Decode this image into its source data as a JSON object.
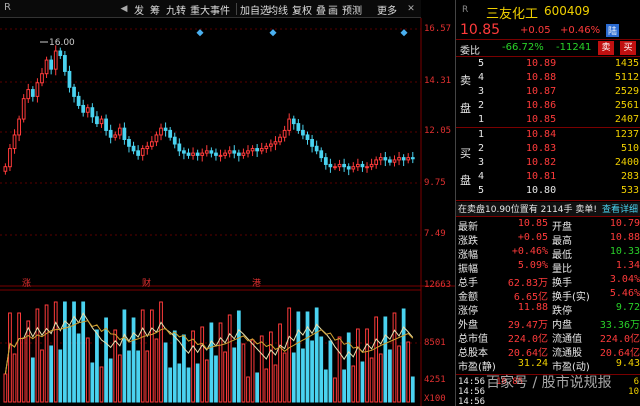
{
  "toolbar": {
    "left_marker": "R",
    "items": [
      "发",
      "筹",
      "九转",
      "重大事件",
      "加自选",
      "均线",
      "复权",
      "叠",
      "画",
      "预测",
      "更多"
    ]
  },
  "chart": {
    "price_ticks": [
      "16.57",
      "14.31",
      "12.05",
      "9.75",
      "7.49"
    ],
    "volume_ticks": [
      "12663",
      "8501",
      "4251",
      "X100"
    ],
    "high_label": "16.00",
    "event_labels": [
      "涨",
      "财",
      "港"
    ]
  },
  "panel": {
    "header_marker": "R",
    "stock_name": "三友化工",
    "stock_code": "600409",
    "price": "10.85",
    "change": "+0.05",
    "change_pct": "+0.46%",
    "badge": "陆",
    "weibi_label": "委比",
    "weibi_pct": "-66.72%",
    "weibi_val": "-11241",
    "sell_btn": "卖",
    "buy_btn": "买",
    "sell_side_label": [
      "卖",
      "盘"
    ],
    "buy_side_label": [
      "买",
      "盘"
    ],
    "sells": [
      {
        "lvl": "5",
        "price": "10.89",
        "vol": "1435"
      },
      {
        "lvl": "4",
        "price": "10.88",
        "vol": "5112"
      },
      {
        "lvl": "3",
        "price": "10.87",
        "vol": "2529"
      },
      {
        "lvl": "2",
        "price": "10.86",
        "vol": "2561"
      },
      {
        "lvl": "1",
        "price": "10.85",
        "vol": "2407"
      }
    ],
    "buys": [
      {
        "lvl": "1",
        "price": "10.84",
        "vol": "1237"
      },
      {
        "lvl": "2",
        "price": "10.83",
        "vol": "510"
      },
      {
        "lvl": "3",
        "price": "10.82",
        "vol": "2400"
      },
      {
        "lvl": "4",
        "price": "10.81",
        "vol": "283"
      },
      {
        "lvl": "5",
        "price": "10.80",
        "vol": "533"
      }
    ],
    "order_text": "在卖盘10.90位置有 2114手 卖单!",
    "order_link": "查看详细",
    "stats": [
      [
        "最新",
        "10.85",
        "开盘",
        "10.79"
      ],
      [
        "涨跌",
        "+0.05",
        "最高",
        "10.88"
      ],
      [
        "涨幅",
        "+0.46%",
        "最低",
        "10.33"
      ],
      [
        "振幅",
        "5.09%",
        "量比",
        "1.34"
      ],
      [
        "总手",
        "62.83万",
        "换手",
        "3.04%"
      ],
      [
        "金额",
        "6.65亿",
        "换手(实)",
        "5.46%"
      ],
      [
        "涨停",
        "11.88",
        "跌停",
        "9.72"
      ],
      [
        "外盘",
        "29.47万",
        "内盘",
        "33.36万"
      ],
      [
        "总市值",
        "224.0亿",
        "流通值",
        "224.0亿"
      ],
      [
        "总股本",
        "20.64亿",
        "流通股",
        "20.64亿"
      ],
      [
        "市盈(静)",
        "31.24",
        "市盈(动)",
        "9.43"
      ]
    ],
    "ticks": [
      {
        "time": "14:56",
        "price": "10.85",
        "vol": "6"
      },
      {
        "time": "14:56",
        "price": "",
        "vol": "10"
      },
      {
        "time": "14:56",
        "price": "",
        "vol": ""
      }
    ],
    "watermark": "百家号 / 股市说规报"
  }
}
